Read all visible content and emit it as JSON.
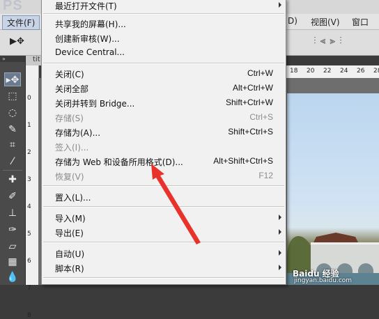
{
  "app": {
    "logo": "PS"
  },
  "menubar": {
    "file": "文件(F)",
    "d_partial": "D)",
    "view": "视图(V)",
    "window": "窗口"
  },
  "doc_tab": "tit",
  "vruler": [
    "0",
    "1",
    "2",
    "3",
    "4",
    "5",
    "6",
    "7",
    "8"
  ],
  "hruler": [
    "18",
    "20",
    "22",
    "24",
    "26",
    "28"
  ],
  "watermark": {
    "main": "Baidu 经验",
    "url": "jingyan.baidu.com"
  },
  "menu": {
    "recent": {
      "label": "最近打开文件(T)"
    },
    "share_screen": {
      "label": "共享我的屏幕(H)..."
    },
    "new_review": {
      "label": "创建新审核(W)..."
    },
    "device_central": {
      "label": "Device Central..."
    },
    "close": {
      "label": "关闭(C)",
      "shortcut": "Ctrl+W"
    },
    "close_all": {
      "label": "关闭全部",
      "shortcut": "Alt+Ctrl+W"
    },
    "close_bridge": {
      "label": "关闭并转到 Bridge...",
      "shortcut": "Shift+Ctrl+W"
    },
    "save": {
      "label": "存储(S)",
      "shortcut": "Ctrl+S"
    },
    "save_as": {
      "label": "存储为(A)...",
      "shortcut": "Shift+Ctrl+S"
    },
    "checkin": {
      "label": "签入(I)..."
    },
    "save_web": {
      "label": "存储为 Web 和设备所用格式(D)...",
      "shortcut": "Alt+Shift+Ctrl+S"
    },
    "revert": {
      "label": "恢复(V)",
      "shortcut": "F12"
    },
    "place": {
      "label": "置入(L)..."
    },
    "import": {
      "label": "导入(M)"
    },
    "export": {
      "label": "导出(E)"
    },
    "automate": {
      "label": "自动(U)"
    },
    "scripts": {
      "label": "脚本(R)"
    }
  },
  "colors": {
    "menu_bg": "#f1f1f1",
    "highlight_file": "#c8d4e6",
    "annotation_arrow": "#e8322b",
    "disabled_text": "#8b8b8b"
  }
}
